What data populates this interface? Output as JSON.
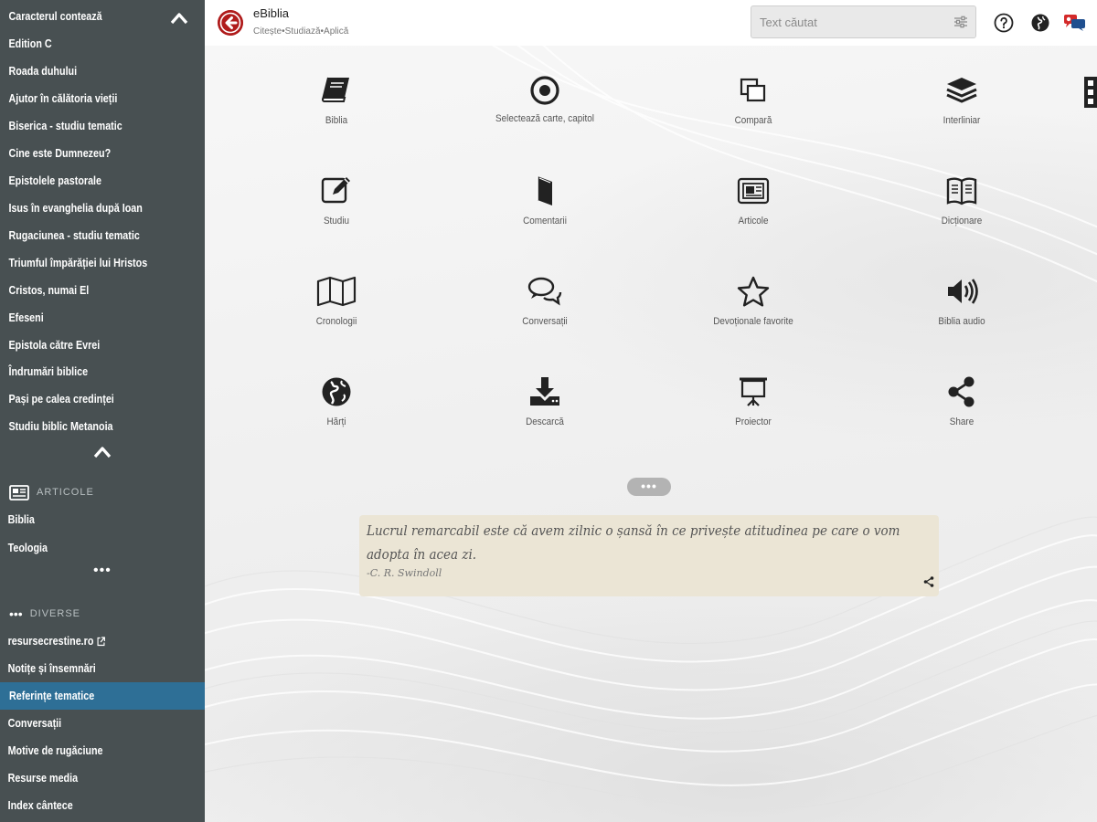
{
  "sidebar": {
    "top_items": [
      "Caracterul contează",
      "Edition C",
      "Roada duhului",
      "Ajutor în călătoria vieții",
      "Biserica - studiu tematic",
      "Cine este Dumnezeu?",
      "Epistolele pastorale",
      "Isus în evanghelia după Ioan",
      "Rugaciunea - studiu tematic",
      "Triumful împărăției lui Hristos",
      "Cristos, numai El",
      "Efeseni",
      "Epistola către Evrei",
      "Îndrumări biblice",
      "Pași pe calea credinței",
      "Studiu biblic Metanoia"
    ],
    "articole_header": "ARTICOLE",
    "articole_items": [
      "Biblia",
      "Teologia"
    ],
    "more_dots": "•••",
    "diverse_header": "DIVERSE",
    "diverse_items": [
      "resursecrestine.ro",
      "Notițe și însemnări",
      "Referințe tematice",
      "Conversații",
      "Motive de rugăciune",
      "Resurse media",
      "Index cântece"
    ],
    "active_item": "Referințe tematice",
    "active_color": "#2e6f96"
  },
  "header": {
    "title": "eBiblia",
    "subtitle": "Citește•Studiază•Aplică",
    "search_placeholder": "Text căutat",
    "brand_color": "#b01c1c",
    "icons": [
      "help-icon",
      "globe-icon",
      "chat-icon"
    ]
  },
  "tiles": [
    {
      "label": "Biblia",
      "icon": "book-icon"
    },
    {
      "label": "Selectează carte, capitol",
      "icon": "target-icon"
    },
    {
      "label": "Compară",
      "icon": "compare-icon"
    },
    {
      "label": "Interliniar",
      "icon": "layers-icon"
    },
    {
      "label": "Studiu",
      "icon": "edit-icon"
    },
    {
      "label": "Comentarii",
      "icon": "commentary-book-icon"
    },
    {
      "label": "Articole",
      "icon": "newspaper-icon"
    },
    {
      "label": "Dicționare",
      "icon": "open-book-icon"
    },
    {
      "label": "Cronologii",
      "icon": "map-icon"
    },
    {
      "label": "Conversații",
      "icon": "chat-bubbles-icon"
    },
    {
      "label": "Devoționale favorite",
      "icon": "star-icon"
    },
    {
      "label": "Biblia audio",
      "icon": "speaker-icon"
    },
    {
      "label": "Hărți",
      "icon": "globe-icon"
    },
    {
      "label": "Descarcă",
      "icon": "download-icon"
    },
    {
      "label": "Proiector",
      "icon": "projector-icon"
    },
    {
      "label": "Share",
      "icon": "share-icon"
    }
  ],
  "more_pill": "•••",
  "quote": {
    "text": "Lucrul remarcabil este că avem zilnic o șansă în ce privește atitudinea pe care o vom adopta în acea zi.",
    "author": "-C. R. Swindoll",
    "background": "#ebe5d5"
  }
}
